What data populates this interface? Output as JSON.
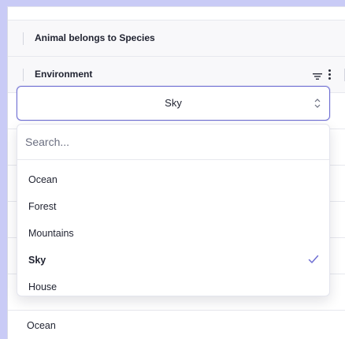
{
  "columns": {
    "species_header": "Animal belongs to Species",
    "environment_header": "Environment"
  },
  "select": {
    "value": "Sky"
  },
  "dropdown": {
    "search_placeholder": "Search...",
    "options": [
      {
        "label": "Ocean",
        "selected": false
      },
      {
        "label": "Forest",
        "selected": false
      },
      {
        "label": "Mountains",
        "selected": false
      },
      {
        "label": "Sky",
        "selected": true
      },
      {
        "label": "House",
        "selected": false
      }
    ]
  },
  "rows": {
    "next_cell": "Ocean"
  },
  "colors": {
    "accent": "#6f6fd3",
    "frame": "#c9cbf6"
  }
}
